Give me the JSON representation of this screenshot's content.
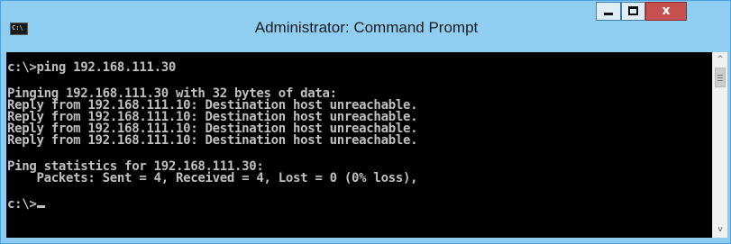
{
  "window": {
    "title": "Administrator: Command Prompt",
    "icon": "cmd-icon",
    "controls": {
      "minimize_icon": "minimize-icon",
      "maximize_icon": "maximize-icon",
      "close_glyph": "x"
    },
    "colors": {
      "frame": "#8ecbf0",
      "close": "#c75050",
      "console_bg": "#000000",
      "console_text": "#c0c0c0"
    }
  },
  "console": {
    "lines": [
      "c:\\>ping 192.168.111.30",
      "",
      "Pinging 192.168.111.30 with 32 bytes of data:",
      "Reply from 192.168.111.10: Destination host unreachable.",
      "Reply from 192.168.111.10: Destination host unreachable.",
      "Reply from 192.168.111.10: Destination host unreachable.",
      "Reply from 192.168.111.10: Destination host unreachable.",
      "",
      "Ping statistics for 192.168.111.30:",
      "    Packets: Sent = 4, Received = 4, Lost = 0 (0% loss),",
      "",
      "c:\\>"
    ]
  },
  "scrollbar": {
    "up_icon": "scroll-up-arrow-icon",
    "down_icon": "scroll-down-arrow-icon",
    "up_glyph": "^",
    "down_glyph": "v"
  }
}
